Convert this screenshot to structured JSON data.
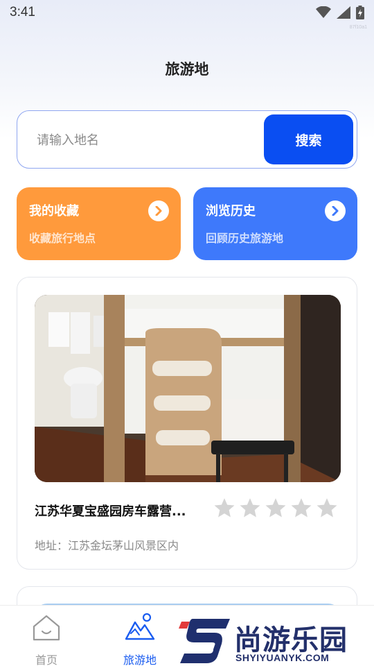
{
  "status_bar": {
    "time": "3:41",
    "small_text": "87f10a1"
  },
  "page": {
    "title": "旅游地"
  },
  "search": {
    "placeholder": "请输入地名",
    "button_label": "搜索"
  },
  "quick_links": [
    {
      "title": "我的收藏",
      "subtitle": "收藏旅行地点",
      "color": "#ff9a3c"
    },
    {
      "title": "浏览历史",
      "subtitle": "回顾历史旅游地",
      "color": "#3e79fb"
    }
  ],
  "places": [
    {
      "name": "江苏华夏宝盛园房车露营...",
      "address": "地址：江苏金坛茅山风景区内",
      "rating": 0,
      "rating_max": 5
    }
  ],
  "tabs": [
    {
      "label": "首页",
      "icon": "home-icon",
      "active": false
    },
    {
      "label": "旅游地",
      "icon": "mountain-pin-icon",
      "active": true
    }
  ],
  "watermark": {
    "text": "尚游乐园",
    "url": "SHYIYUANYK.COM"
  },
  "colors": {
    "accent": "#0a4ef2",
    "orange": "#ff9a3c",
    "blue_card": "#3e79fb",
    "star_empty": "#d4d4d4"
  }
}
